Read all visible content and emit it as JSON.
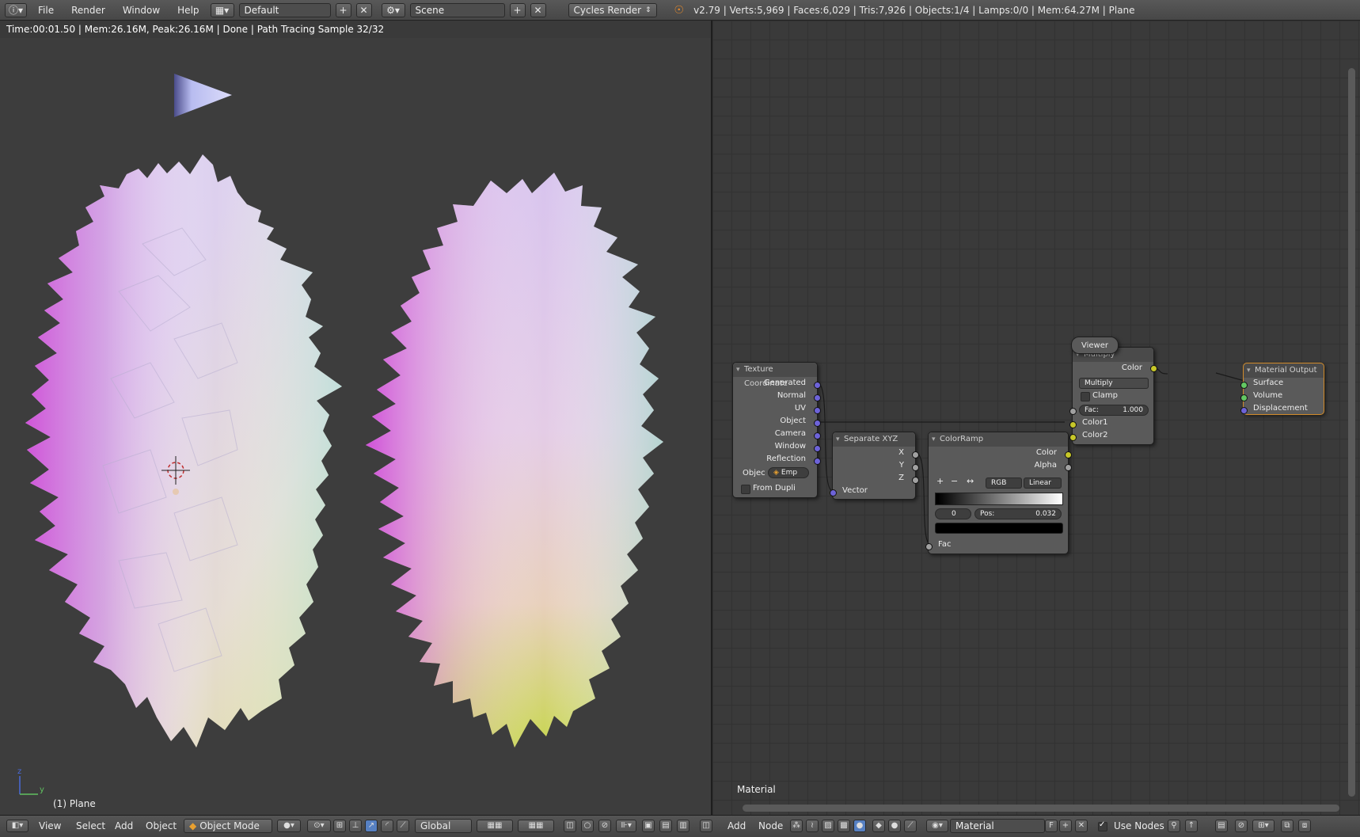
{
  "topbar": {
    "menus": [
      "File",
      "Render",
      "Window",
      "Help"
    ],
    "screen_layout": "Default",
    "scene": "Scene",
    "render_engine": "Cycles Render",
    "stats": "v2.79 | Verts:5,969 | Faces:6,029 | Tris:7,926 | Objects:1/4 | Lamps:0/0 | Mem:64.27M | Plane"
  },
  "viewport": {
    "header_status": "Time:00:01.50 | Mem:26.16M, Peak:26.16M | Done | Path Tracing Sample 32/32",
    "object_label": "(1) Plane",
    "axis_z": "z",
    "axis_y": "y"
  },
  "node_editor": {
    "material_label": "Material",
    "nodes": {
      "texture_coordinate": {
        "title": "Texture Coordinate",
        "outputs": [
          "Generated",
          "Normal",
          "UV",
          "Object",
          "Camera",
          "Window",
          "Reflection"
        ],
        "object_label": "Objec",
        "object_value": "Emp",
        "from_dupli": "From Dupli"
      },
      "separate_xyz": {
        "title": "Separate XYZ",
        "outputs": [
          "X",
          "Y",
          "Z"
        ],
        "input": "Vector"
      },
      "color_ramp": {
        "title": "ColorRamp",
        "outputs": [
          "Color",
          "Alpha"
        ],
        "mode": "RGB",
        "interpolation": "Linear",
        "stop_index": "0",
        "pos_label": "Pos:",
        "pos_value": "0.032",
        "input": "Fac"
      },
      "multiply": {
        "title": "Multiply",
        "output": "Color",
        "blend_type": "Multiply",
        "clamp": "Clamp",
        "fac_label": "Fac:",
        "fac_value": "1.000",
        "inputs": [
          "Color1",
          "Color2"
        ]
      },
      "viewer": {
        "title": "Viewer"
      },
      "material_output": {
        "title": "Material Output",
        "inputs": [
          "Surface",
          "Volume",
          "Displacement"
        ]
      }
    }
  },
  "bottombar": {
    "left_menus": [
      "View",
      "Select",
      "Add",
      "Object"
    ],
    "mode": "Object Mode",
    "orientation": "Global",
    "right_menus": [
      "Add",
      "Node"
    ],
    "material_name": "Material",
    "fake_user": "F",
    "use_nodes": "Use Nodes"
  },
  "colors": {
    "socket_vector": "#6d63d8",
    "socket_color": "#c7c729",
    "socket_float": "#a1a1a1",
    "socket_shader": "#63c763",
    "active_node_border": "#d08a2a"
  }
}
